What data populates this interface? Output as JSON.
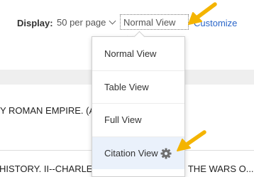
{
  "toolbar": {
    "display_label": "Display:",
    "per_page": "50 per page",
    "view_selected": "Normal View",
    "customize": "Customize"
  },
  "view_menu": {
    "items": [
      "Normal View",
      "Table View",
      "Full View",
      "Citation View"
    ],
    "highlighted": "Citation View"
  },
  "results": {
    "line1": "Y ROMAN EMPIRE. (A",
    "line2": "HISTORY. II--CHARLEMAGNE. EARLY LIFE. THE WARS O..."
  },
  "icons": {
    "gear": "gear-icon",
    "chevron": "chevron-down-icon",
    "arrow": "annotation-arrow-icon"
  },
  "colors": {
    "link": "#2a66c9",
    "arrow": "#f4b400",
    "highlight": "#eaf1fb"
  }
}
